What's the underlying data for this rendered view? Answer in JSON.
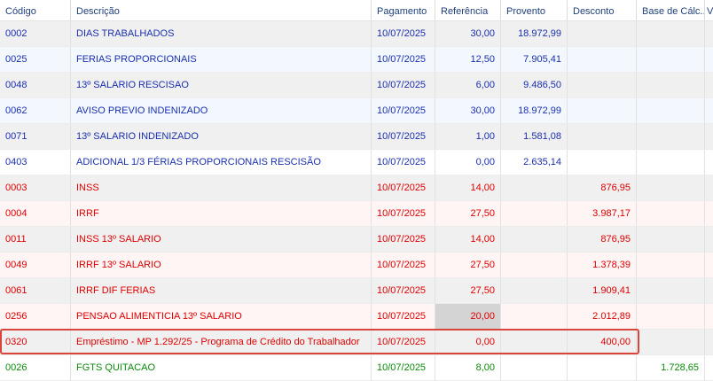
{
  "columns": {
    "codigo": "Código",
    "descricao": "Descrição",
    "pagamento": "Pagamento",
    "referencia": "Referência",
    "provento": "Provento",
    "desconto": "Desconto",
    "base": "Base de Cálc...",
    "extra": "Va"
  },
  "rows": [
    {
      "codigo": "0002",
      "descricao": "DIAS TRABALHADOS",
      "pagamento": "10/07/2025",
      "referencia": "30,00",
      "provento": "18.972,99",
      "desconto": "",
      "base": ""
    },
    {
      "codigo": "0025",
      "descricao": "FERIAS PROPORCIONAIS",
      "pagamento": "10/07/2025",
      "referencia": "12,50",
      "provento": "7.905,41",
      "desconto": "",
      "base": ""
    },
    {
      "codigo": "0048",
      "descricao": "13º SALARIO RESCISAO",
      "pagamento": "10/07/2025",
      "referencia": "6,00",
      "provento": "9.486,50",
      "desconto": "",
      "base": ""
    },
    {
      "codigo": "0062",
      "descricao": "AVISO PREVIO INDENIZADO",
      "pagamento": "10/07/2025",
      "referencia": "30,00",
      "provento": "18.972,99",
      "desconto": "",
      "base": ""
    },
    {
      "codigo": "0071",
      "descricao": "13º SALARIO INDENIZADO",
      "pagamento": "10/07/2025",
      "referencia": "1,00",
      "provento": "1.581,08",
      "desconto": "",
      "base": ""
    },
    {
      "codigo": "0403",
      "descricao": "ADICIONAL 1/3 FÉRIAS PROPORCIONAIS RESCISÃO",
      "pagamento": "10/07/2025",
      "referencia": "0,00",
      "provento": "2.635,14",
      "desconto": "",
      "base": ""
    },
    {
      "codigo": "0003",
      "descricao": "INSS",
      "pagamento": "10/07/2025",
      "referencia": "14,00",
      "provento": "",
      "desconto": "876,95",
      "base": ""
    },
    {
      "codigo": "0004",
      "descricao": "IRRF",
      "pagamento": "10/07/2025",
      "referencia": "27,50",
      "provento": "",
      "desconto": "3.987,17",
      "base": ""
    },
    {
      "codigo": "0011",
      "descricao": "INSS 13º SALARIO",
      "pagamento": "10/07/2025",
      "referencia": "14,00",
      "provento": "",
      "desconto": "876,95",
      "base": ""
    },
    {
      "codigo": "0049",
      "descricao": "IRRF 13º SALARIO",
      "pagamento": "10/07/2025",
      "referencia": "27,50",
      "provento": "",
      "desconto": "1.378,39",
      "base": ""
    },
    {
      "codigo": "0061",
      "descricao": "IRRF DIF FERIAS",
      "pagamento": "10/07/2025",
      "referencia": "27,50",
      "provento": "",
      "desconto": "1.909,41",
      "base": ""
    },
    {
      "codigo": "0256",
      "descricao": "PENSAO ALIMENTICIA 13º SALARIO",
      "pagamento": "10/07/2025",
      "referencia": "20,00",
      "provento": "",
      "desconto": "2.012,89",
      "base": ""
    },
    {
      "codigo": "0320",
      "descricao": "Empréstimo - MP 1.292/25 - Programa de Crédito do Trabalhador",
      "pagamento": "10/07/2025",
      "referencia": "0,00",
      "provento": "",
      "desconto": "400,00",
      "base": ""
    },
    {
      "codigo": "0026",
      "descricao": "FGTS QUITACAO",
      "pagamento": "10/07/2025",
      "referencia": "8,00",
      "provento": "",
      "desconto": "",
      "base": "1.728,65"
    }
  ],
  "colors": {
    "provento_text": "#1a2fb0",
    "desconto_text": "#e00000",
    "base_text": "#0a8a0a",
    "highlight_border": "#d9443b"
  }
}
